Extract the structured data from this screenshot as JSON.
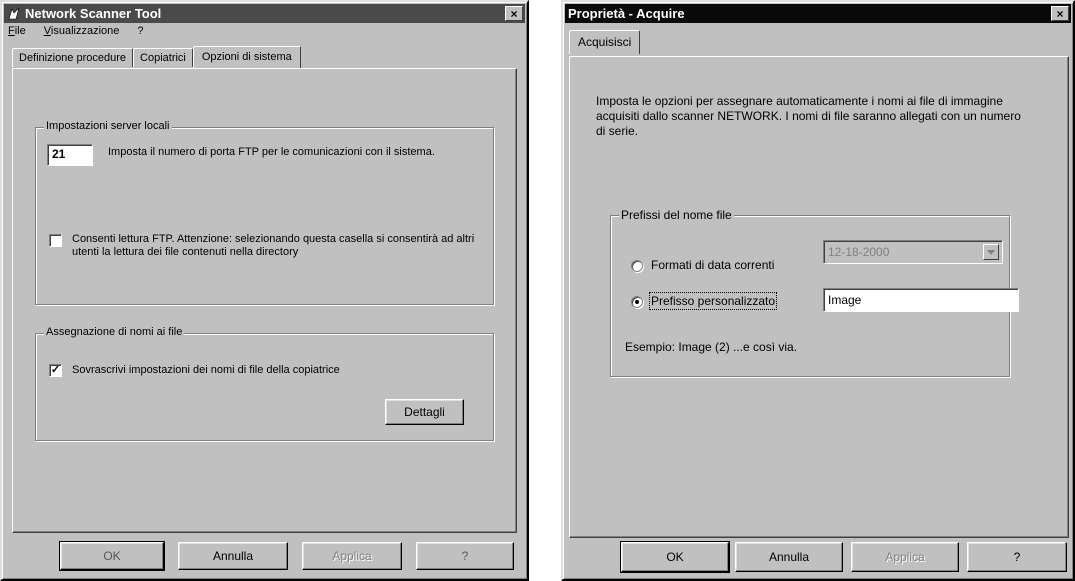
{
  "left_window": {
    "title": "Network Scanner Tool",
    "close_glyph": "×",
    "app_icon": "scanner-icon",
    "menu": {
      "file": "File",
      "view": "Visualizzazione",
      "help": "?"
    },
    "tabs": [
      {
        "label": "Definizione procedure",
        "active": false
      },
      {
        "label": "Copiatrici",
        "active": false
      },
      {
        "label": "Opzioni di sistema",
        "active": true
      }
    ],
    "local_server_group": {
      "legend": "Impostazioni server locali",
      "port_value": "21",
      "port_description": "Imposta il numero di porta FTP per le comunicazioni con il sistema.",
      "ftp_read_checked": false,
      "ftp_read_label": "Consenti lettura FTP. Attenzione: selezionando questa casella si consentirà ad altri utenti la lettura dei file contenuti nella directory"
    },
    "naming_group": {
      "legend": "Assegnazione di nomi ai file",
      "overwrite_checked": true,
      "overwrite_label": "Sovrascrivi impostazioni dei nomi di file della copiatrice",
      "details_button": "Dettagli"
    },
    "buttons": {
      "ok": "OK",
      "cancel": "Annulla",
      "apply": "Applica",
      "help": "?"
    }
  },
  "right_window": {
    "title": "Proprietà - Acquire",
    "close_glyph": "×",
    "tab": "Acquisisci",
    "intro_text": "Imposta le opzioni per assegnare automaticamente i nomi ai file di immagine acquisiti dallo scanner NETWORK. I nomi di file saranno allegati con un numero di serie.",
    "prefix_group": {
      "legend": "Prefissi del nome file",
      "date_format_label": "Formati di data correnti",
      "date_format_checked": false,
      "date_format_value": "12-18-2000",
      "custom_prefix_label": "Prefisso personalizzato",
      "custom_prefix_checked": true,
      "custom_prefix_value": "Image",
      "example_text": "Esempio: Image (2) ...e così via."
    },
    "buttons": {
      "ok": "OK",
      "cancel": "Annulla",
      "apply": "Applica",
      "help": "?"
    }
  }
}
